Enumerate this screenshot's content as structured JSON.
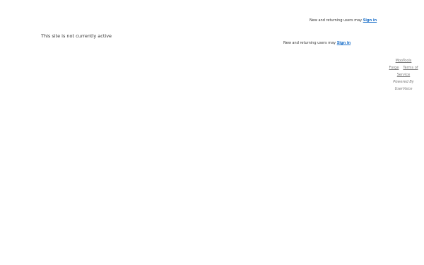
{
  "header": {
    "signin_prompt": "New and returning users may",
    "signin_link": "Sign in"
  },
  "main": {
    "status_message": "This site is not currently active",
    "signin_prompt": "New and returning users may",
    "signin_link": "Sign in"
  },
  "footer": {
    "brand_link_part1": "MooTools",
    "brand_link_part2": "Forge",
    "terms_link_part1": "Terms of",
    "terms_link_part2": "Service",
    "powered_by": "Powered By",
    "provider": "UserVoice"
  },
  "colors": {
    "link": "#1a6fc9",
    "text": "#333333",
    "muted": "#777777",
    "background": "#ffffff"
  }
}
